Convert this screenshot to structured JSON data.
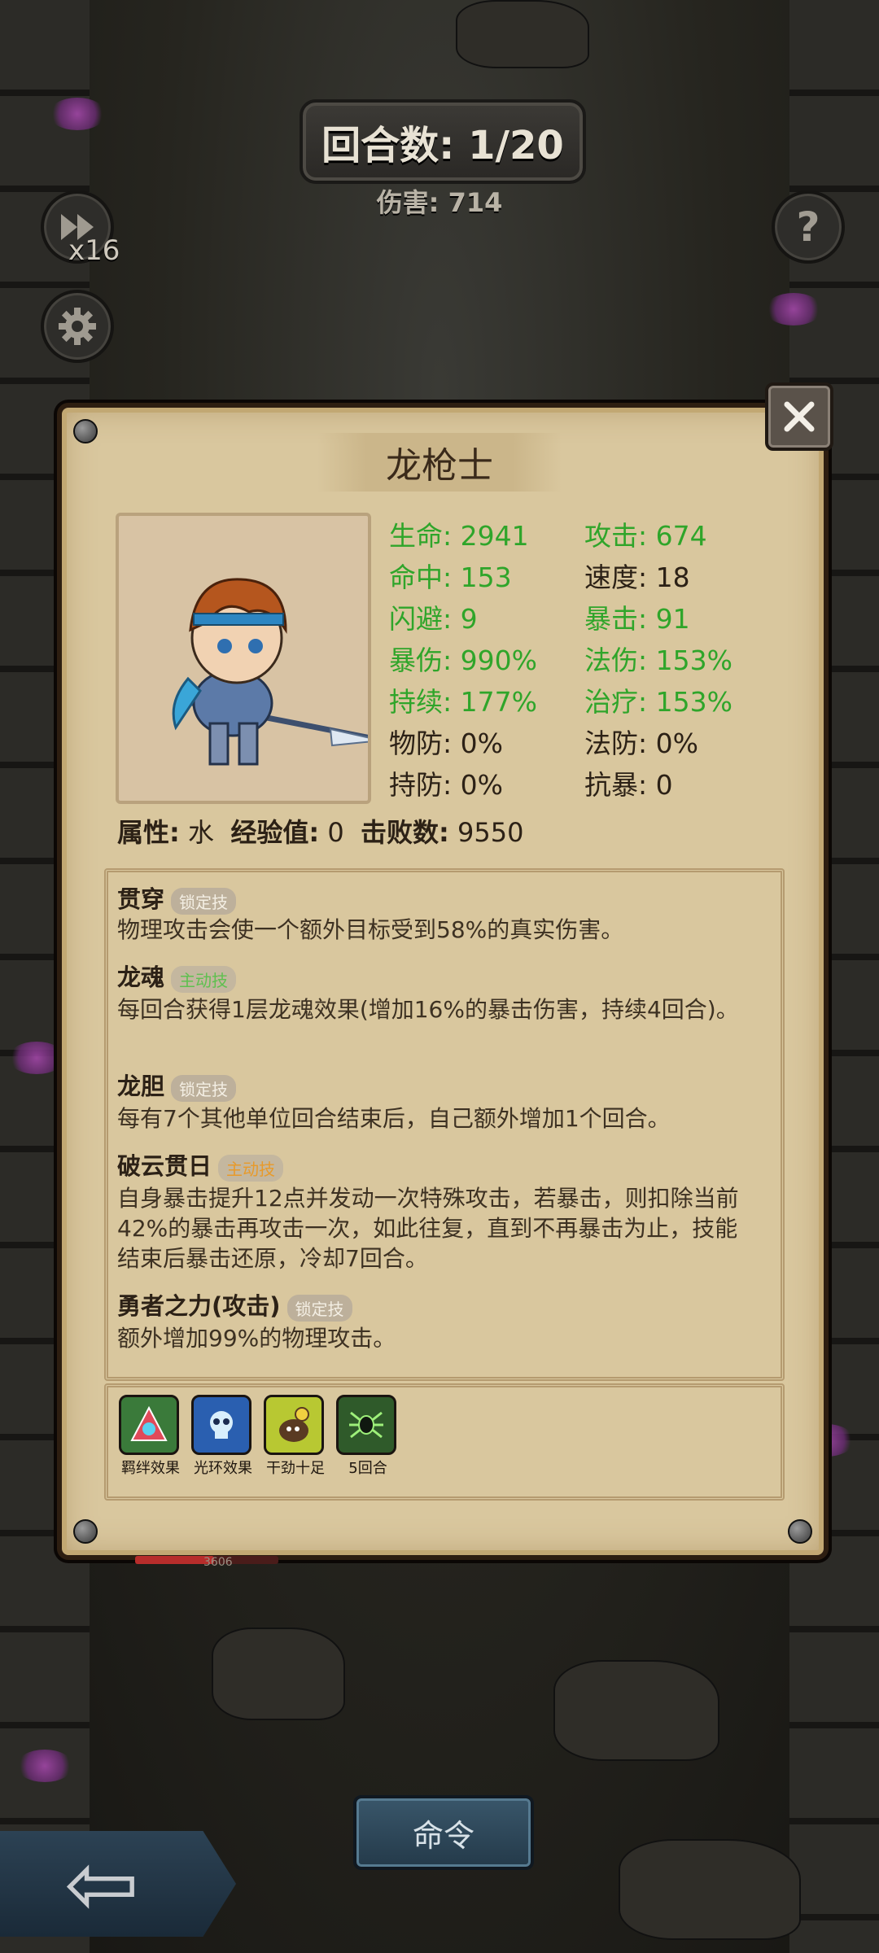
{
  "hud": {
    "round": "回合数: 1/20",
    "damage": "伤害: 714",
    "speed": "x16",
    "help": "?"
  },
  "hero": {
    "name": "龙枪士",
    "stats": [
      {
        "label": "生命: 2941",
        "tone": "green"
      },
      {
        "label": "攻击: 674",
        "tone": "green"
      },
      {
        "label": "命中: 153",
        "tone": "green"
      },
      {
        "label": "速度: 18",
        "tone": "dark"
      },
      {
        "label": "闪避: 9",
        "tone": "green"
      },
      {
        "label": "暴击: 91",
        "tone": "green"
      },
      {
        "label": "暴伤: 990%",
        "tone": "green"
      },
      {
        "label": "法伤: 153%",
        "tone": "green"
      },
      {
        "label": "持续: 177%",
        "tone": "green"
      },
      {
        "label": "治疗: 153%",
        "tone": "green"
      },
      {
        "label": "物防: 0%",
        "tone": "dark"
      },
      {
        "label": "法防: 0%",
        "tone": "dark"
      },
      {
        "label": "持防: 0%",
        "tone": "dark"
      },
      {
        "label": "抗暴: 0",
        "tone": "dark"
      }
    ],
    "attribute_label": "属性:",
    "attribute_value": "水",
    "exp_label": "经验值:",
    "exp_value": "0",
    "kills_label": "击败数:",
    "kills_value": "9550"
  },
  "skills": [
    {
      "name": "贯穿",
      "tag": "锁定技",
      "tag_type": "lock",
      "desc": "物理攻击会使一个额外目标受到58%的真实伤害。"
    },
    {
      "name": "龙魂",
      "tag": "主动技",
      "tag_type": "active-g",
      "desc": "每回合获得1层龙魂效果(增加16%的暴击伤害，持续4回合)。"
    },
    {
      "name": "龙胆",
      "tag": "锁定技",
      "tag_type": "lock",
      "desc": "每有7个其他单位回合结束后，自己额外增加1个回合。"
    },
    {
      "name": "破云贯日",
      "tag": "主动技",
      "tag_type": "active-o",
      "desc": "自身暴击提升12点并发动一次特殊攻击，若暴击，则扣除当前42%的暴击再攻击一次，如此往复，直到不再暴击为止，技能结束后暴击还原，冷却7回合。"
    },
    {
      "name": "勇者之力(攻击)",
      "tag": "锁定技",
      "tag_type": "lock",
      "desc": "额外增加99%的物理攻击。"
    }
  ],
  "buffs": [
    {
      "label": "羁绊效果",
      "icon": "bond-icon",
      "color": "#3a7a3a"
    },
    {
      "label": "光环效果",
      "icon": "skull-aura-icon",
      "color": "#2a5fb0"
    },
    {
      "label": "干劲十足",
      "icon": "motivated-icon",
      "color": "#b8c832"
    },
    {
      "label": "5回合",
      "icon": "spider-icon",
      "color": "#2f5a2a"
    }
  ],
  "unit_hp": {
    "value": "3606",
    "fraction": 0.55
  },
  "command_label": "命令",
  "colors": {
    "stat_green": "#2fa52a",
    "panel": "#d9c79e",
    "accent_orange": "#e89a2a"
  }
}
